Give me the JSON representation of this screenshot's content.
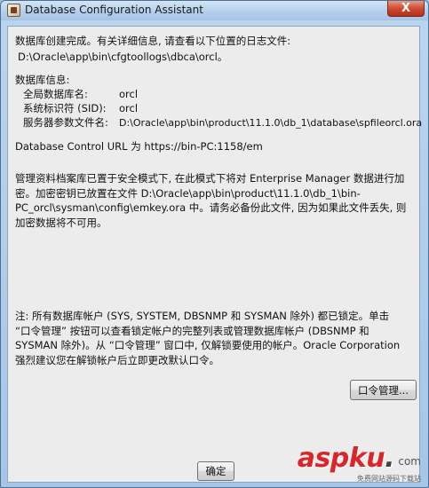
{
  "window": {
    "title": "Database Configuration Assistant",
    "close_glyph": "X"
  },
  "messages": {
    "complete": "数据库创建完成。有关详细信息, 请查看以下位置的日志文件:",
    "log_path": "D:\\Oracle\\app\\bin\\cfgtoollogs\\dbca\\orcl。",
    "db_info_header": "数据库信息:",
    "info_rows": [
      {
        "label": "全局数据库名:",
        "value": "orcl"
      },
      {
        "label": "系统标识符 (SID):",
        "value": "orcl"
      },
      {
        "label": "服务器参数文件名:",
        "value": "D:\\Oracle\\app\\bin\\product\\11.1.0\\db_1\\database\\spfileorcl.ora"
      }
    ],
    "em_url": "Database Control URL 为 https://bin-PC:1158/em",
    "repository_note": "管理资料档案库已置于安全模式下, 在此模式下将对 Enterprise Manager 数据进行加密。加密密钥已放置在文件 D:\\Oracle\\app\\bin\\product\\11.1.0\\db_1\\bin-PC_orcl\\sysman\\config\\emkey.ora 中。请务必备份此文件, 因为如果此文件丢失, 则加密数据将不可用。",
    "accounts_note": "注: 所有数据库帐户 (SYS, SYSTEM, DBSNMP 和 SYSMAN 除外) 都已锁定。单击 “口令管理” 按钮可以查看锁定帐户的完整列表或管理数据库帐户 (DBSNMP 和 SYSMAN 除外)。从 “口令管理” 窗口中, 仅解锁要使用的帐户。Oracle Corporation 强烈建议您在解锁帐户后立即更改默认口令。"
  },
  "buttons": {
    "password_mgmt": "口令管理...",
    "ok": "确定"
  },
  "watermark": {
    "brand": "aspku",
    "dot": ".",
    "tld": "com",
    "tagline": "免费网站源码下载站"
  }
}
